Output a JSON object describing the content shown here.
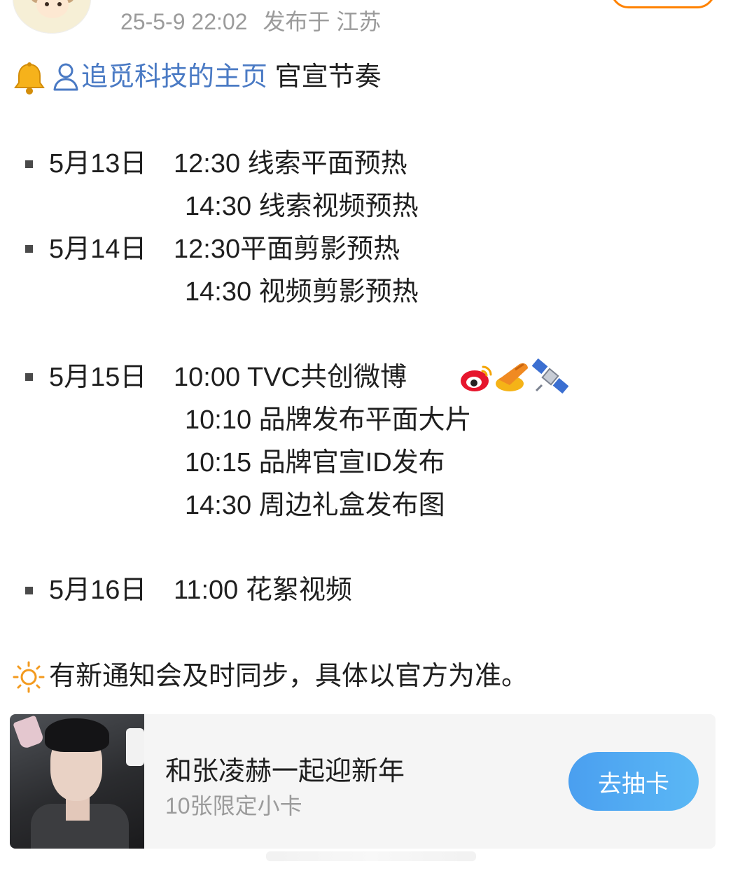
{
  "post": {
    "time": "25-5-9 22:02",
    "location": "发布于 江苏",
    "mention_link": "追觅科技的主页",
    "headline_suffix": " 官宣节奏"
  },
  "schedule": [
    {
      "date": "5月13日",
      "entries": [
        "12:30 线索平面预热",
        "14:30 线索视频预热"
      ]
    },
    {
      "date": "5月14日",
      "entries": [
        "12:30平面剪影预热",
        "14:30 视频剪影预热"
      ]
    },
    {
      "date": "5月15日",
      "entries": [
        "10:00 TVC共创微博",
        "10:10 品牌发布平面大片",
        "10:15 品牌官宣ID发布",
        "14:30 周边礼盒发布图"
      ]
    },
    {
      "date": "5月16日",
      "entries": [
        " 11:00 花絮视频"
      ]
    }
  ],
  "notice": "有新通知会及时同步，具体以官方为准。",
  "card": {
    "title": "和张凌赫一起迎新年",
    "subtitle": "10张限定小卡",
    "button_label": "去抽卡"
  },
  "icons": [
    "bell-icon",
    "user-icon",
    "weibo-icon",
    "rocket-icon",
    "satellite-icon",
    "sun-icon"
  ],
  "colors": {
    "link": "#4a7ac4",
    "meta": "#9b9b9b",
    "button": "#4a9ff0",
    "follow_border": "#ff8200"
  }
}
